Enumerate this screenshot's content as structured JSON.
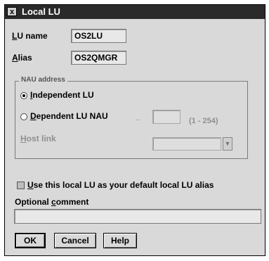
{
  "window": {
    "title": "Local LU",
    "system_menu": "x"
  },
  "fields": {
    "lu_name": {
      "label_prefix": "L",
      "label_rest": "U name",
      "value": "OS2LU"
    },
    "alias": {
      "label_prefix": "A",
      "label_rest": "lias",
      "value": "OS2QMGR"
    }
  },
  "nau_group": {
    "title": "NAU address",
    "independent": {
      "prefix": "I",
      "rest": "ndependent LU",
      "selected": true
    },
    "dependent": {
      "prefix": "D",
      "rest": "ependent LU NAU",
      "selected": false
    },
    "dash": "_",
    "nau_value": "",
    "range": "(1 - 254)",
    "host_link": {
      "prefix": "H",
      "rest": "ost link",
      "value": ""
    }
  },
  "default_alias": {
    "prefix": "U",
    "rest": "se this local LU as your default local LU alias",
    "checked": false
  },
  "comment": {
    "prefix": "Optional ",
    "underlined": "c",
    "rest": "omment",
    "value": ""
  },
  "buttons": {
    "ok": "OK",
    "cancel": "Cancel",
    "help": "Help"
  }
}
